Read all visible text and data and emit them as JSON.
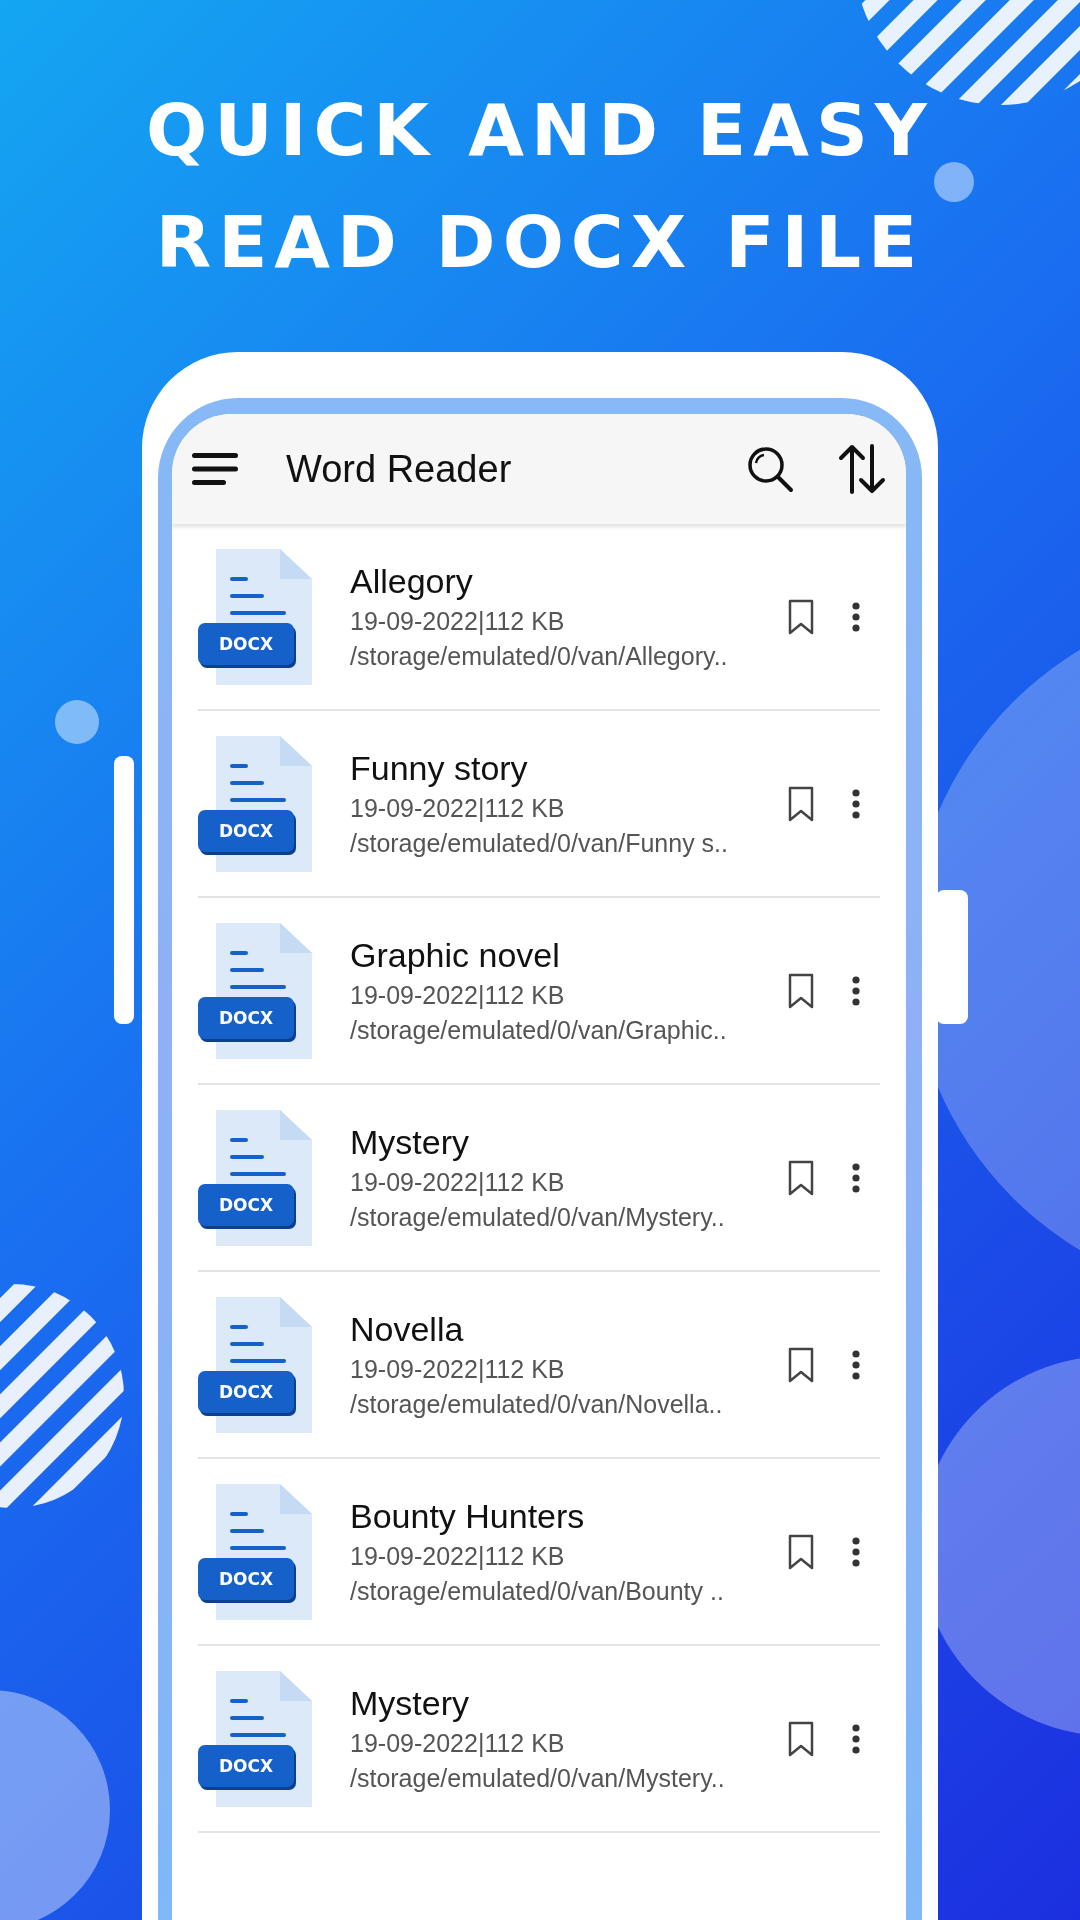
{
  "headline": [
    "QUICK AND EASY",
    "READ DOCX FILE"
  ],
  "app_bar": {
    "title": "Word Reader"
  },
  "files": [
    {
      "name": "Allegory",
      "badge": "DOCX",
      "meta": "19-09-2022|112 KB",
      "path": "/storage/emulated/0/van/Allegory.."
    },
    {
      "name": "Funny story",
      "badge": "DOCX",
      "meta": "19-09-2022|112 KB",
      "path": "/storage/emulated/0/van/Funny s.."
    },
    {
      "name": "Graphic novel",
      "badge": "DOCX",
      "meta": "19-09-2022|112 KB",
      "path": "/storage/emulated/0/van/Graphic.."
    },
    {
      "name": "Mystery",
      "badge": "DOCX",
      "meta": "19-09-2022|112 KB",
      "path": "/storage/emulated/0/van/Mystery.."
    },
    {
      "name": "Novella",
      "badge": "DOCX",
      "meta": "19-09-2022|112 KB",
      "path": "/storage/emulated/0/van/Novella.."
    },
    {
      "name": "Bounty Hunters",
      "badge": "DOCX",
      "meta": "19-09-2022|112 KB",
      "path": "/storage/emulated/0/van/Bounty .."
    },
    {
      "name": "Mystery",
      "badge": "DOCX",
      "meta": "19-09-2022|112 KB",
      "path": "/storage/emulated/0/van/Mystery.."
    }
  ]
}
